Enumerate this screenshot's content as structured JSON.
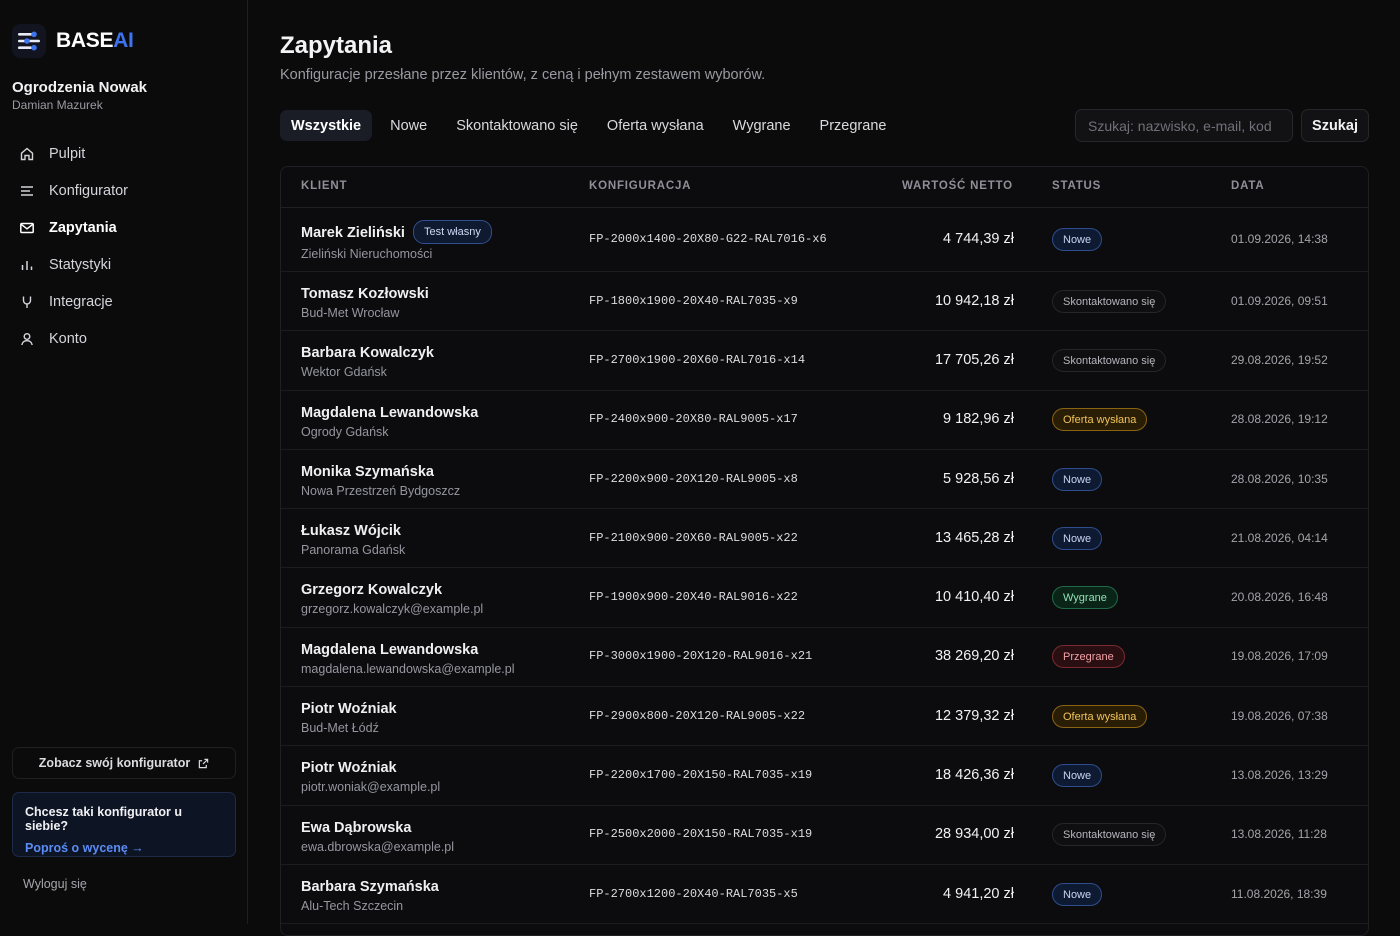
{
  "brand": {
    "name_main": "BASE",
    "name_accent": "AI",
    "accent_color": "#3d73ef"
  },
  "account": {
    "company": "Ogrodzenia Nowak",
    "user": "Damian Mazurek"
  },
  "nav": [
    {
      "label": "Pulpit",
      "icon": "home-icon",
      "active": false
    },
    {
      "label": "Konfigurator",
      "icon": "sliders-icon",
      "active": false
    },
    {
      "label": "Zapytania",
      "icon": "mail-icon",
      "active": true
    },
    {
      "label": "Statystyki",
      "icon": "bar-chart-icon",
      "active": false
    },
    {
      "label": "Integracje",
      "icon": "plug-icon",
      "active": false
    },
    {
      "label": "Konto",
      "icon": "user-icon",
      "active": false
    }
  ],
  "sidebar_footer": {
    "see_config": "Zobacz swój konfigurator",
    "promo_title": "Chcesz taki konfigurator u siebie?",
    "promo_link": "Poproś o wycenę →",
    "logout": "Wyloguj się"
  },
  "page": {
    "title": "Zapytania",
    "subtitle": "Konfiguracje przesłane przez klientów, z ceną i pełnym zestawem wyborów."
  },
  "filters": [
    {
      "label": "Wszystkie",
      "active": true
    },
    {
      "label": "Nowe",
      "active": false
    },
    {
      "label": "Skontaktowano się",
      "active": false
    },
    {
      "label": "Oferta wysłana",
      "active": false
    },
    {
      "label": "Wygrane",
      "active": false
    },
    {
      "label": "Przegrane",
      "active": false
    }
  ],
  "search": {
    "placeholder": "Szukaj: nazwisko, e-mail, kod",
    "value": "",
    "button": "Szukaj"
  },
  "table": {
    "headers": {
      "client": "KLIENT",
      "config": "KONFIGURACJA",
      "value": "WARTOŚĆ NETTO",
      "status": "STATUS",
      "date": "DATA"
    },
    "rows": [
      {
        "name": "Marek Zieliński",
        "tag": "Test własny",
        "sub": "Zieliński Nieruchomości",
        "config": "FP-2000x1400-20X80-G22-RAL7016-x6",
        "value": "4 744,39 zł",
        "status": "Nowe",
        "status_kind": "nowe",
        "date": "01.09.2026, 14:38"
      },
      {
        "name": "Tomasz Kozłowski",
        "tag": "",
        "sub": "Bud-Met Wrocław",
        "config": "FP-1800x1900-20X40-RAL7035-x9",
        "value": "10 942,18 zł",
        "status": "Skontaktowano się",
        "status_kind": "skont",
        "date": "01.09.2026, 09:51"
      },
      {
        "name": "Barbara Kowalczyk",
        "tag": "",
        "sub": "Wektor Gdańsk",
        "config": "FP-2700x1900-20X60-RAL7016-x14",
        "value": "17 705,26 zł",
        "status": "Skontaktowano się",
        "status_kind": "skont",
        "date": "29.08.2026, 19:52"
      },
      {
        "name": "Magdalena Lewandowska",
        "tag": "",
        "sub": "Ogrody Gdańsk",
        "config": "FP-2400x900-20X80-RAL9005-x17",
        "value": "9 182,96 zł",
        "status": "Oferta wysłana",
        "status_kind": "oferta",
        "date": "28.08.2026, 19:12"
      },
      {
        "name": "Monika Szymańska",
        "tag": "",
        "sub": "Nowa Przestrzeń Bydgoszcz",
        "config": "FP-2200x900-20X120-RAL9005-x8",
        "value": "5 928,56 zł",
        "status": "Nowe",
        "status_kind": "nowe",
        "date": "28.08.2026, 10:35"
      },
      {
        "name": "Łukasz Wójcik",
        "tag": "",
        "sub": "Panorama Gdańsk",
        "config": "FP-2100x900-20X60-RAL9005-x22",
        "value": "13 465,28 zł",
        "status": "Nowe",
        "status_kind": "nowe",
        "date": "21.08.2026, 04:14"
      },
      {
        "name": "Grzegorz Kowalczyk",
        "tag": "",
        "sub": "grzegorz.kowalczyk@example.pl",
        "config": "FP-1900x900-20X40-RAL9016-x22",
        "value": "10 410,40 zł",
        "status": "Wygrane",
        "status_kind": "wygrane",
        "date": "20.08.2026, 16:48"
      },
      {
        "name": "Magdalena Lewandowska",
        "tag": "",
        "sub": "magdalena.lewandowska@example.pl",
        "config": "FP-3000x1900-20X120-RAL9016-x21",
        "value": "38 269,20 zł",
        "status": "Przegrane",
        "status_kind": "przegrane",
        "date": "19.08.2026, 17:09"
      },
      {
        "name": "Piotr Woźniak",
        "tag": "",
        "sub": "Bud-Met Łódź",
        "config": "FP-2900x800-20X120-RAL9005-x22",
        "value": "12 379,32 zł",
        "status": "Oferta wysłana",
        "status_kind": "oferta",
        "date": "19.08.2026, 07:38"
      },
      {
        "name": "Piotr Woźniak",
        "tag": "",
        "sub": "piotr.woniak@example.pl",
        "config": "FP-2200x1700-20X150-RAL7035-x19",
        "value": "18 426,36 zł",
        "status": "Nowe",
        "status_kind": "nowe",
        "date": "13.08.2026, 13:29"
      },
      {
        "name": "Ewa Dąbrowska",
        "tag": "",
        "sub": "ewa.dbrowska@example.pl",
        "config": "FP-2500x2000-20X150-RAL7035-x19",
        "value": "28 934,00 zł",
        "status": "Skontaktowano się",
        "status_kind": "skont",
        "date": "13.08.2026, 11:28"
      },
      {
        "name": "Barbara Szymańska",
        "tag": "",
        "sub": "Alu-Tech Szczecin",
        "config": "FP-2700x1200-20X40-RAL7035-x5",
        "value": "4 941,20 zł",
        "status": "Nowe",
        "status_kind": "nowe",
        "date": "11.08.2026, 18:39"
      }
    ]
  }
}
